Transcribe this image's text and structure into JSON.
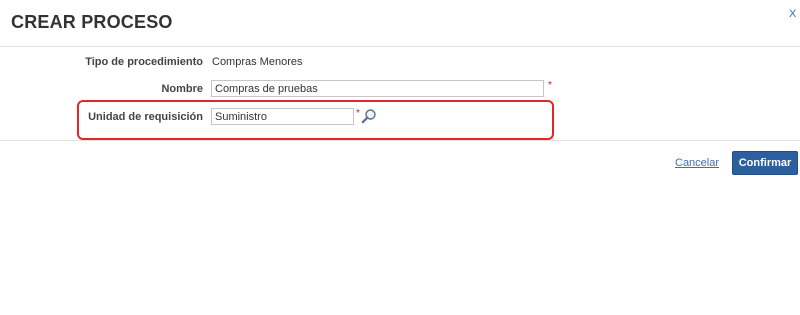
{
  "dialog": {
    "title": "CREAR PROCESO",
    "close_label": "X"
  },
  "form": {
    "tipo_label": "Tipo de procedimiento",
    "tipo_value": "Compras Menores",
    "nombre_label": "Nombre",
    "nombre_value": "Compras de pruebas",
    "unidad_label": "Unidad de requisición",
    "unidad_value": "Suministro",
    "required_mark": "*"
  },
  "actions": {
    "cancel_label": "Cancelar",
    "confirm_label": "Confirmar"
  },
  "icons": {
    "search": "magnifier-icon"
  },
  "colors": {
    "link": "#3b6fb5",
    "primary_button": "#2b5fa0",
    "required": "#d01a1a",
    "highlight_border": "#e02828"
  }
}
